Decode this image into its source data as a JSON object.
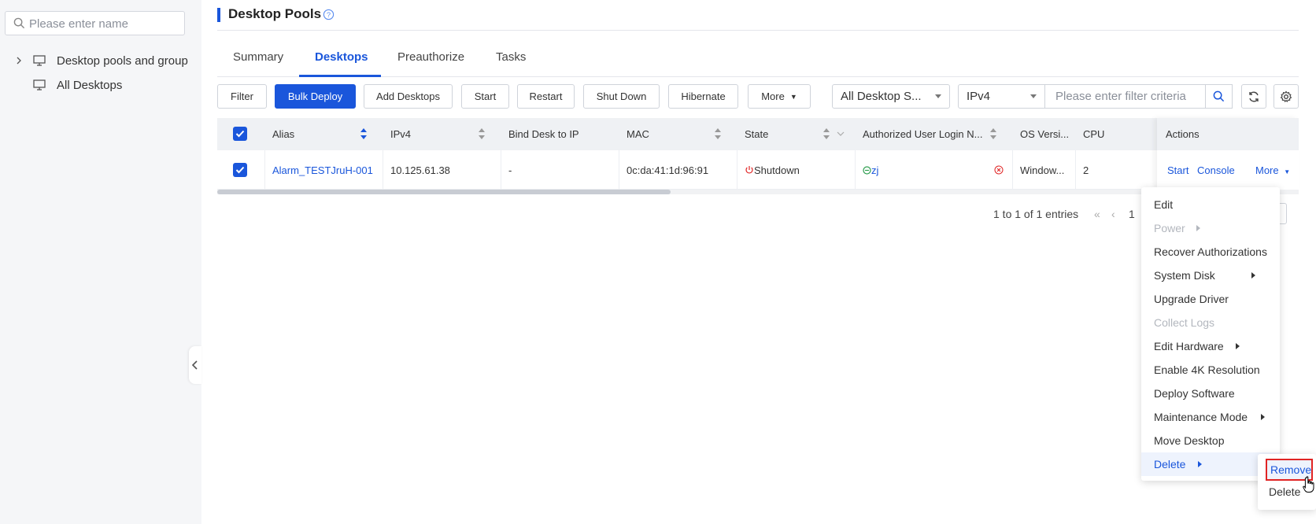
{
  "sidebar": {
    "search_placeholder": "Please enter name",
    "tree": [
      {
        "label": "Desktop pools and group"
      },
      {
        "label": "All Desktops"
      }
    ]
  },
  "header": {
    "title": "Desktop Pools"
  },
  "tabs": [
    {
      "label": "Summary"
    },
    {
      "label": "Desktops",
      "active": true
    },
    {
      "label": "Preauthorize"
    },
    {
      "label": "Tasks"
    }
  ],
  "toolbar": {
    "filter": "Filter",
    "bulk_deploy": "Bulk Deploy",
    "add_desktops": "Add Desktops",
    "start": "Start",
    "restart": "Restart",
    "shut_down": "Shut Down",
    "hibernate": "Hibernate",
    "more": "More",
    "status_select": "All Desktop S...",
    "field_select": "IPv4",
    "filter_placeholder": "Please enter filter criteria"
  },
  "table": {
    "columns": [
      "Alias",
      "IPv4",
      "Bind Desk to IP",
      "MAC",
      "State",
      "Authorized User Login N...",
      "OS Versi...",
      "CPU",
      "Actions"
    ],
    "rows": [
      {
        "alias": "Alarm_TESTJruH-001",
        "ipv4": "10.125.61.38",
        "bind": "-",
        "mac": "0c:da:41:1d:96:91",
        "state": "Shutdown",
        "user": "zj",
        "os": "Window...",
        "cpu": "2",
        "actions": {
          "start": "Start",
          "console": "Console",
          "more": "More"
        }
      }
    ]
  },
  "pagination": {
    "summary": "1 to 1 of 1 entries",
    "page": "1"
  },
  "action_menu": {
    "items": [
      {
        "label": "Edit"
      },
      {
        "label": "Power",
        "disabled": true,
        "submenu": true
      },
      {
        "label": "Recover Authorizations"
      },
      {
        "label": "System Disk",
        "submenu": true
      },
      {
        "label": "Upgrade Driver"
      },
      {
        "label": "Collect Logs",
        "disabled": true
      },
      {
        "label": "Edit Hardware",
        "submenu": true
      },
      {
        "label": "Enable 4K Resolution"
      },
      {
        "label": "Deploy Software"
      },
      {
        "label": "Maintenance Mode",
        "submenu": true
      },
      {
        "label": "Move Desktop"
      },
      {
        "label": "Delete",
        "submenu": true,
        "highlighted": true
      }
    ],
    "delete_submenu": [
      {
        "label": "Remove",
        "highlighted": true
      },
      {
        "label": "Delete"
      }
    ]
  },
  "colors": {
    "primary": "#1a56db",
    "danger": "#e02424",
    "success": "#2e9e4f"
  }
}
